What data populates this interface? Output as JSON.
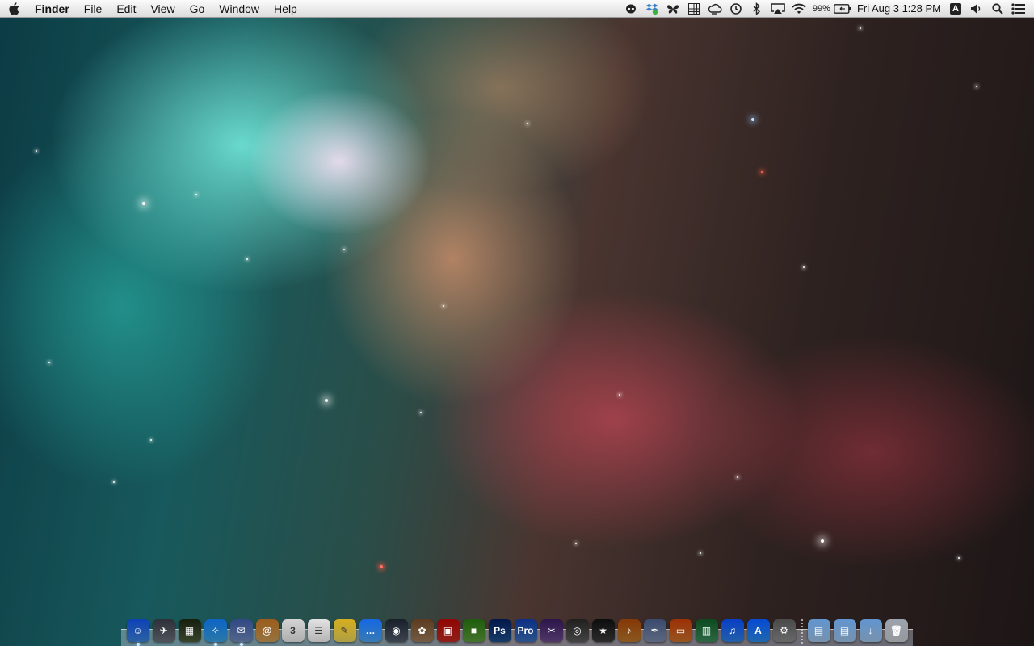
{
  "menubar": {
    "app_name": "Finder",
    "menus": [
      "File",
      "Edit",
      "View",
      "Go",
      "Window",
      "Help"
    ],
    "battery_percent": "99%",
    "datetime": "Fri Aug 3  1:28 PM",
    "input_source": "A",
    "tray_icons": [
      "alien-icon",
      "dropbox-icon",
      "butterfly-icon",
      "grid-icon",
      "cloud-icon",
      "time-machine-icon",
      "bluetooth-icon",
      "airplay-icon",
      "wifi-icon",
      "battery-icon",
      "input-source-icon",
      "volume-icon",
      "spotlight-icon",
      "notification-center-icon"
    ]
  },
  "dock": {
    "apps": [
      {
        "name": "finder-icon",
        "glyph": "☺",
        "color": "#3b82d8",
        "running": true
      },
      {
        "name": "launchpad-icon",
        "glyph": "✈",
        "color": "#6b6f78",
        "running": false
      },
      {
        "name": "mission-control-icon",
        "glyph": "▦",
        "color": "#4a5a3a",
        "running": false
      },
      {
        "name": "safari-icon",
        "glyph": "✧",
        "color": "#3aa0e0",
        "running": true
      },
      {
        "name": "mail-icon",
        "glyph": "✉",
        "color": "#6f88b8",
        "running": true
      },
      {
        "name": "contacts-icon",
        "glyph": "@",
        "color": "#c79a55",
        "running": false
      },
      {
        "name": "calendar-icon",
        "glyph": "3",
        "color": "#e8e8e8",
        "running": false
      },
      {
        "name": "reminders-icon",
        "glyph": "☰",
        "color": "#f0f0f0",
        "running": false
      },
      {
        "name": "notes-icon",
        "glyph": "✎",
        "color": "#e9d35a",
        "running": false
      },
      {
        "name": "messages-icon",
        "glyph": "…",
        "color": "#4aa3f0",
        "running": false
      },
      {
        "name": "facetime-icon",
        "glyph": "◉",
        "color": "#505a68",
        "running": false
      },
      {
        "name": "photo-booth-icon",
        "glyph": "✿",
        "color": "#9a7b5a",
        "running": false
      },
      {
        "name": "photo-stack-icon",
        "glyph": "▣",
        "color": "#c02a22",
        "running": false
      },
      {
        "name": "minecraft-icon",
        "glyph": "■",
        "color": "#5a9a3a",
        "running": false
      },
      {
        "name": "photoshop-icon",
        "glyph": "Ps",
        "color": "#1d4f8a",
        "running": false
      },
      {
        "name": "pro-app-icon",
        "glyph": "Pro",
        "color": "#3a6fb8",
        "running": false
      },
      {
        "name": "final-cut-icon",
        "glyph": "✂",
        "color": "#6a4a8a",
        "running": false
      },
      {
        "name": "image-capture-icon",
        "glyph": "◎",
        "color": "#5a5a5a",
        "running": false
      },
      {
        "name": "imovie-icon",
        "glyph": "★",
        "color": "#3a3a3a",
        "running": false
      },
      {
        "name": "garageband-icon",
        "glyph": "♪",
        "color": "#b8772a",
        "running": false
      },
      {
        "name": "script-editor-icon",
        "glyph": "✒",
        "color": "#7a8aa8",
        "running": false
      },
      {
        "name": "keynote-icon",
        "glyph": "▭",
        "color": "#c8702a",
        "running": false
      },
      {
        "name": "numbers-icon",
        "glyph": "▥",
        "color": "#3a8a5a",
        "running": false
      },
      {
        "name": "itunes-icon",
        "glyph": "♫",
        "color": "#2f7fe0",
        "running": false
      },
      {
        "name": "app-store-icon",
        "glyph": "A",
        "color": "#2a8ae8",
        "running": false
      },
      {
        "name": "system-preferences-icon",
        "glyph": "⚙",
        "color": "#8a8a8a",
        "running": false
      }
    ],
    "stacks": [
      {
        "name": "applications-folder-icon",
        "glyph": "▤",
        "color": "#9ec3e6"
      },
      {
        "name": "documents-folder-icon",
        "glyph": "▤",
        "color": "#9ec3e6"
      },
      {
        "name": "downloads-folder-icon",
        "glyph": "↓",
        "color": "#9ec3e6"
      },
      {
        "name": "trash-icon",
        "glyph": "🗑",
        "color": "#c8ccd2"
      }
    ]
  }
}
